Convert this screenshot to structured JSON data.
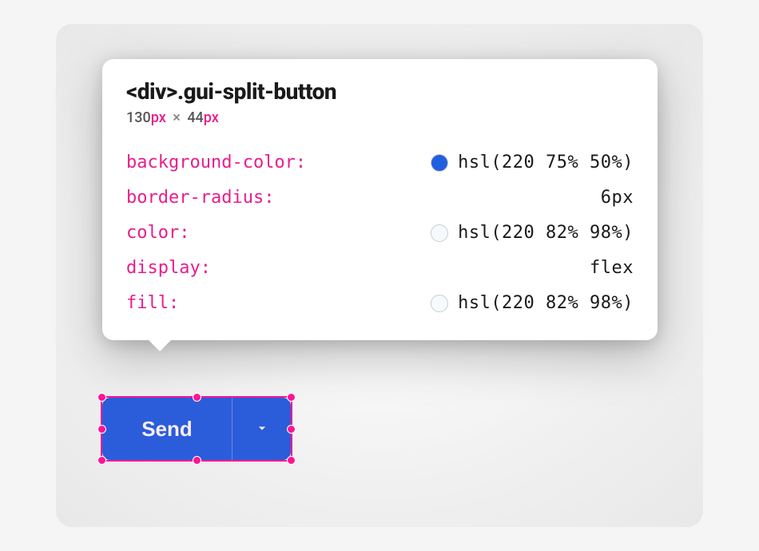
{
  "tooltip": {
    "element_tag": "<div>",
    "element_class": ".gui-split-button",
    "dimensions": {
      "width_num": "130",
      "height_num": "44",
      "unit": "px",
      "times": "×"
    },
    "properties": [
      {
        "name": "background-color",
        "value": "hsl(220 75% 50%)",
        "swatch": "hsl(220, 75%, 50%)"
      },
      {
        "name": "border-radius",
        "value": "6px",
        "swatch": null
      },
      {
        "name": "color",
        "value": "hsl(220 82% 98%)",
        "swatch": "hsl(220, 82%, 98%)"
      },
      {
        "name": "display",
        "value": "flex",
        "swatch": null
      },
      {
        "name": "fill",
        "value": "hsl(220 82% 98%)",
        "swatch": "hsl(220, 82%, 98%)"
      }
    ]
  },
  "splitButton": {
    "label": "Send",
    "background": "hsl(220 75% 50%)",
    "textColor": "hsl(220 82% 98%)"
  }
}
